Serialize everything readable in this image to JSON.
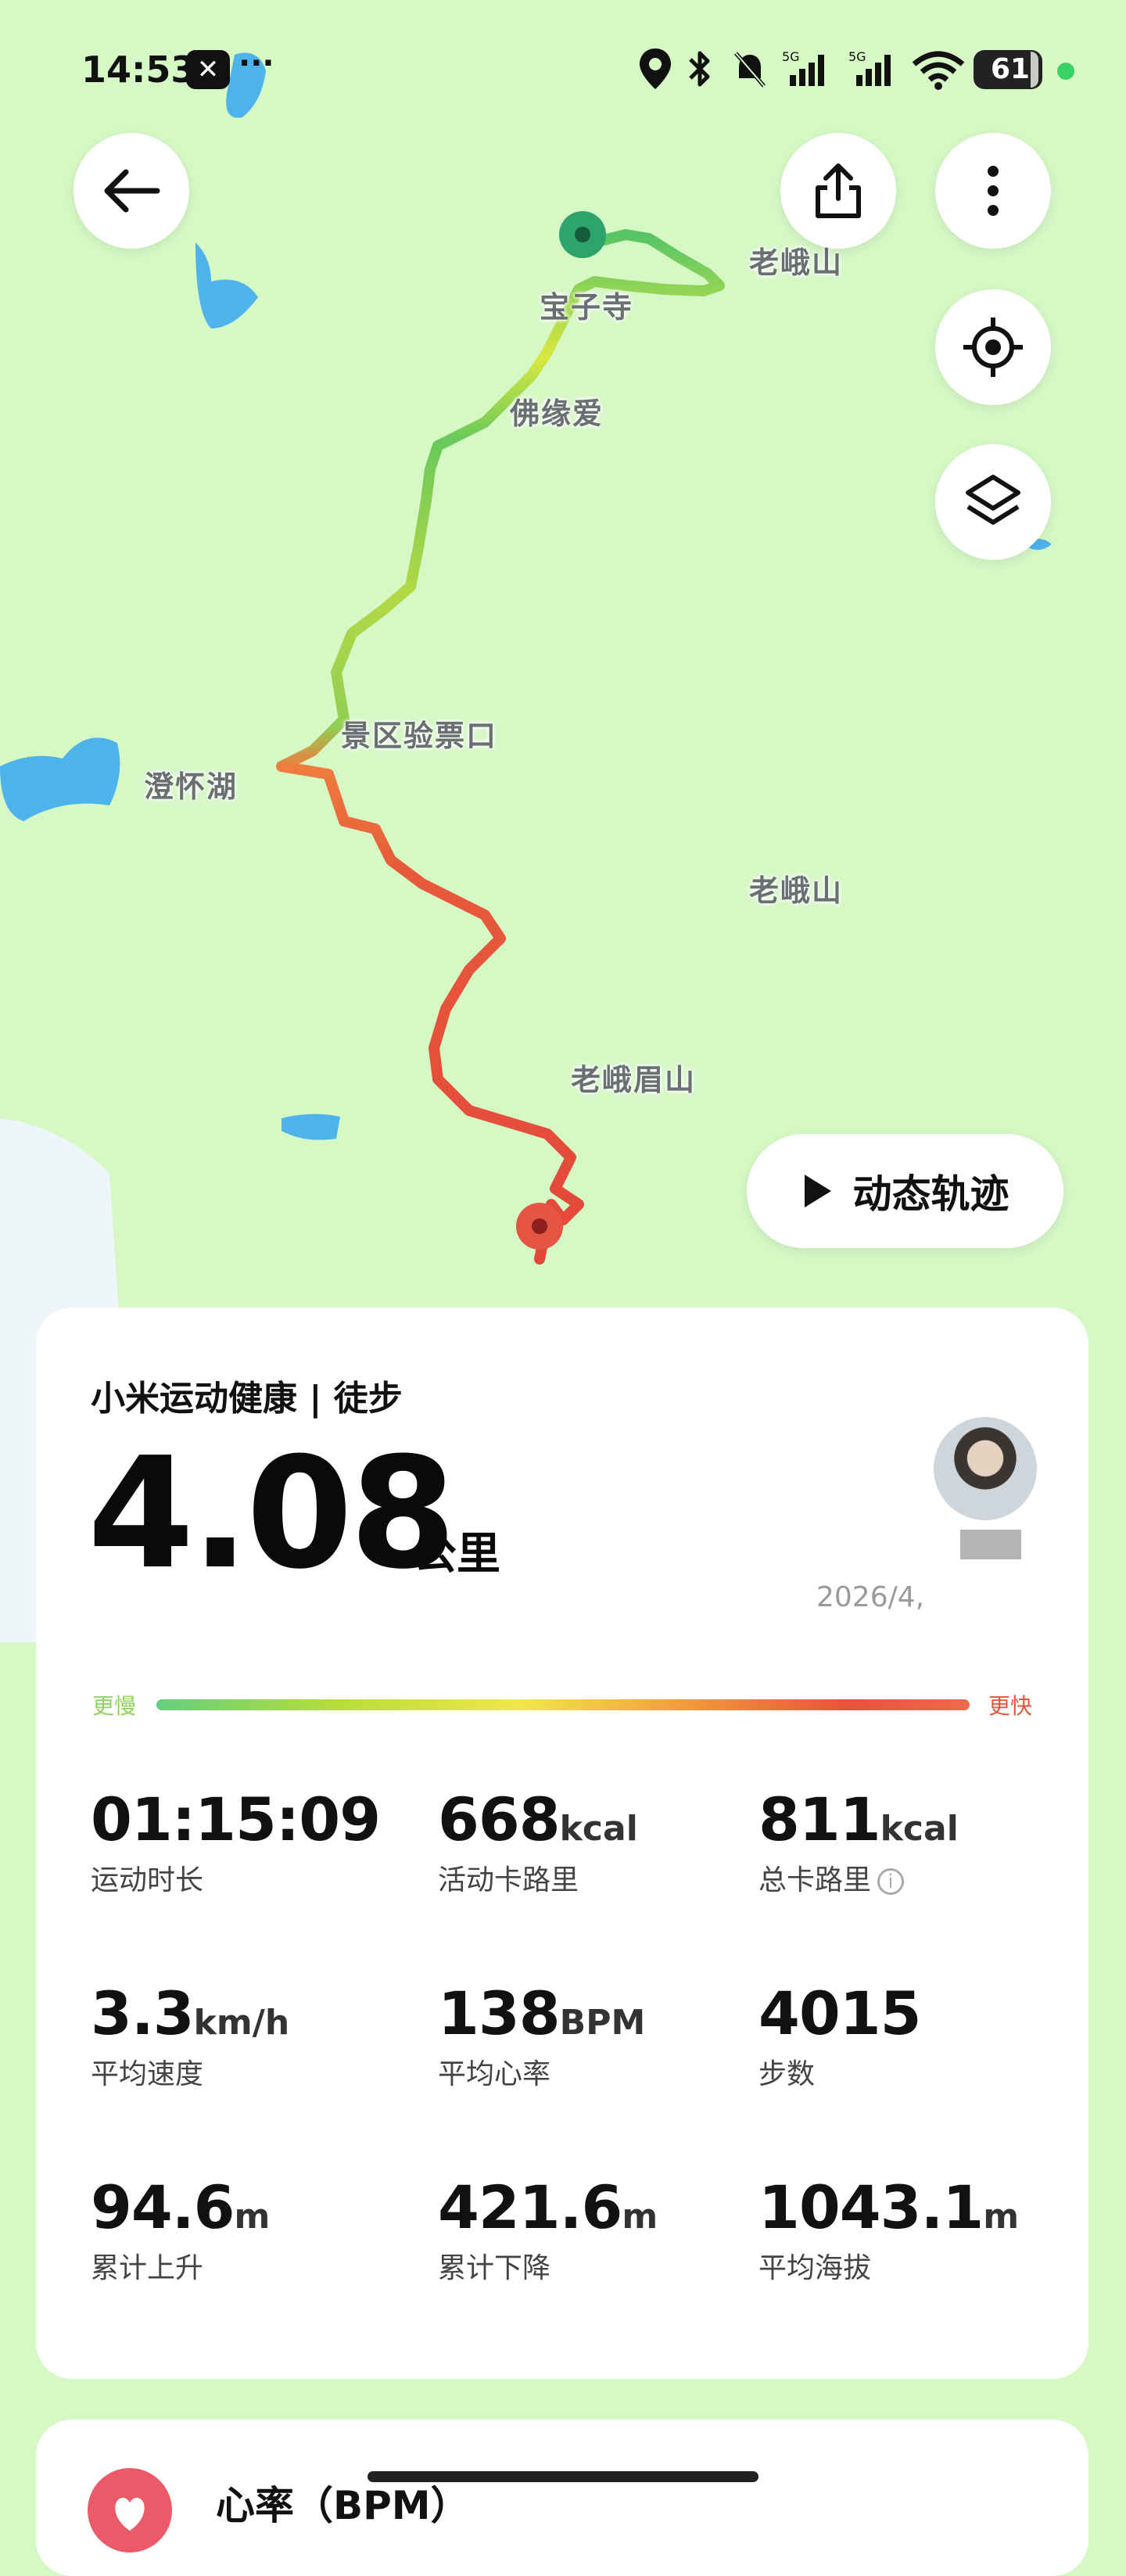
{
  "status_bar": {
    "time": "14:53",
    "app_icon": "app-badge-icon",
    "more": "···",
    "battery_level": "61",
    "network": "5G"
  },
  "map": {
    "labels": {
      "laoe_top": "老峨山",
      "baozi_temple": "宝子寺",
      "foyuan": "佛缘爱",
      "ticket_gate": "景区验票口",
      "chenghuai_lake": "澄怀湖",
      "laoe_mid": "老峨山",
      "laoe_mei": "老峨眉山"
    },
    "buttons": {
      "back": "arrow-left-icon",
      "share": "share-icon",
      "more": "more-vertical-icon",
      "locate": "locate-icon",
      "layers": "layers-icon"
    },
    "replay_label": "动态轨迹"
  },
  "summary": {
    "source": "小米运动健康 | 徒步",
    "distance": "4.08",
    "distance_unit": "公里",
    "date": "2026/4,",
    "pace_slow": "更慢",
    "pace_fast": "更快"
  },
  "stats": [
    {
      "value": "01:15:09",
      "unit": "",
      "label": "运动时长"
    },
    {
      "value": "668",
      "unit": "kcal",
      "label": "活动卡路里"
    },
    {
      "value": "811",
      "unit": "kcal",
      "label": "总卡路里"
    },
    {
      "value": "3.3",
      "unit": "km/h",
      "label": "平均速度"
    },
    {
      "value": "138",
      "unit": "BPM",
      "label": "平均心率"
    },
    {
      "value": "4015",
      "unit": "",
      "label": "步数"
    },
    {
      "value": "94.6",
      "unit": "m",
      "label": "累计上升"
    },
    {
      "value": "421.6",
      "unit": "m",
      "label": "累计下降"
    },
    {
      "value": "1043.1",
      "unit": "m",
      "label": "平均海拔"
    }
  ],
  "heart_section": {
    "title": "心率（BPM）"
  },
  "colors": {
    "map_bg": "#d5f8c5",
    "water": "#4eb3ea",
    "route_start": "#2ea36b",
    "route_end": "#e55544"
  }
}
